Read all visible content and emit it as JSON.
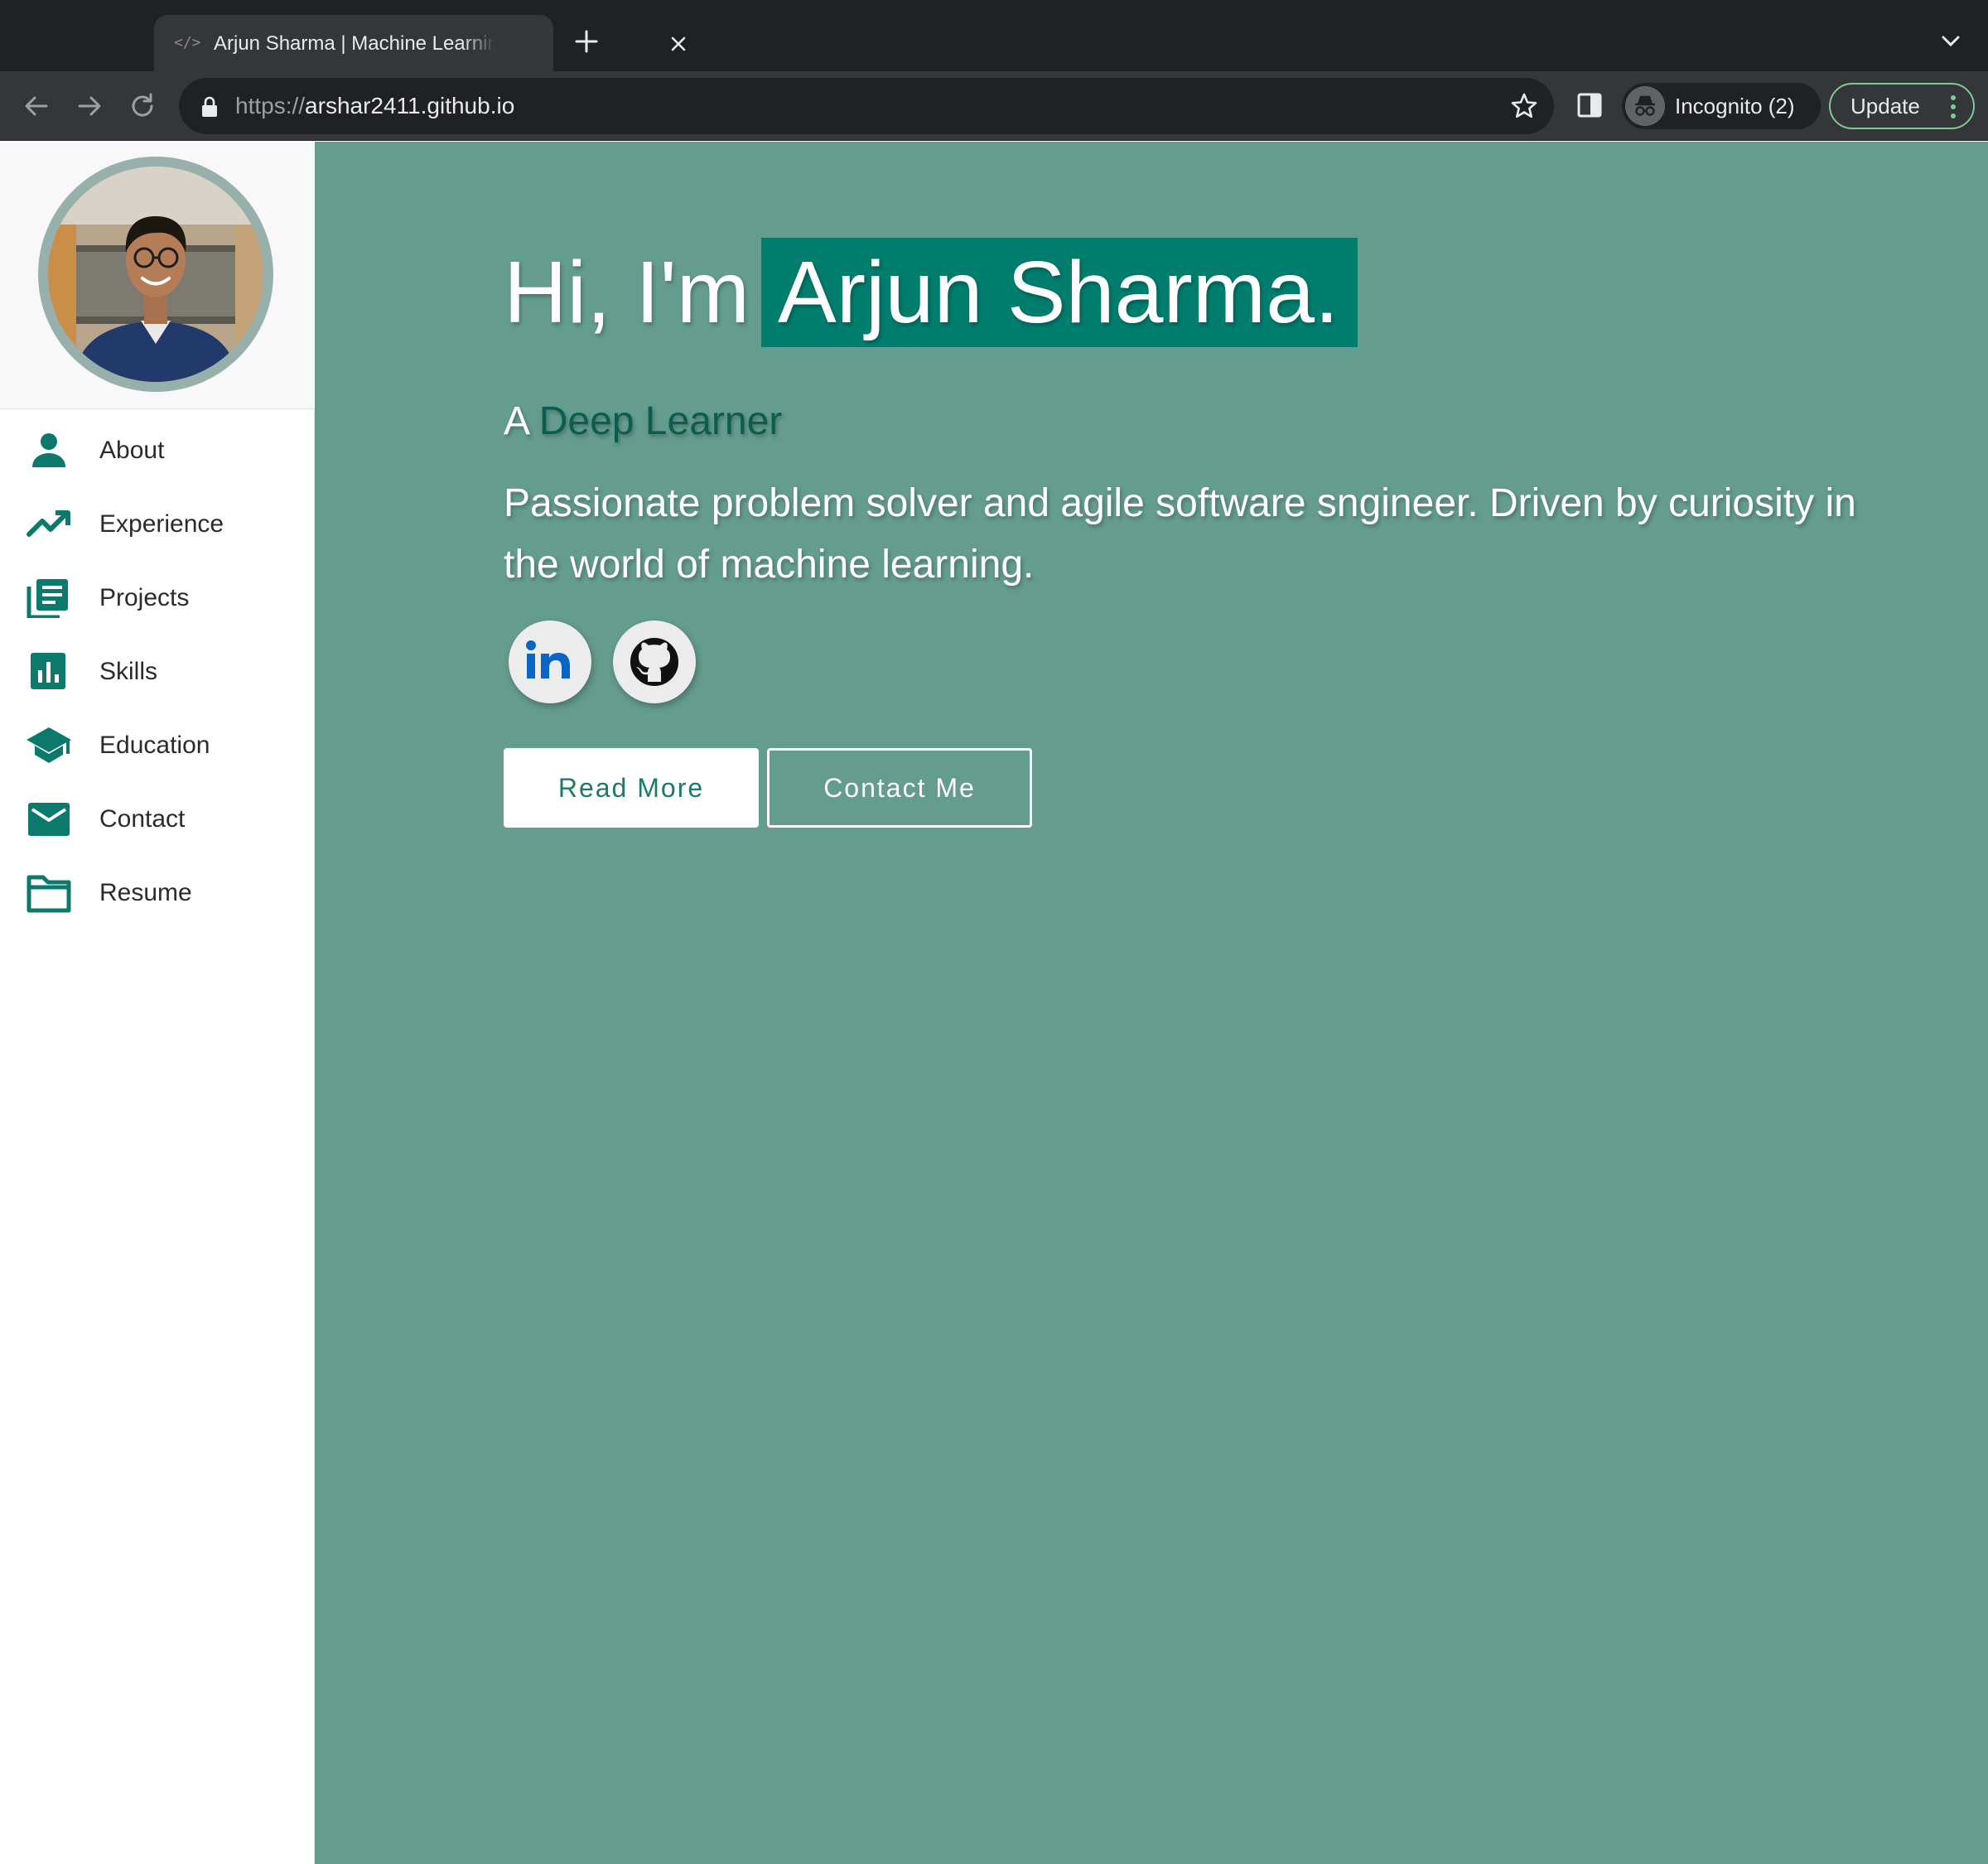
{
  "browser": {
    "tab_title": "Arjun Sharma | Machine Learning",
    "url_scheme": "https://",
    "url_host": "arshar2411.github.io",
    "incognito_label": "Incognito (2)",
    "update_label": "Update"
  },
  "sidebar": {
    "items": [
      {
        "label": "About",
        "icon": "person-icon"
      },
      {
        "label": "Experience",
        "icon": "trending-up-icon"
      },
      {
        "label": "Projects",
        "icon": "library-books-icon"
      },
      {
        "label": "Skills",
        "icon": "bar-chart-icon"
      },
      {
        "label": "Education",
        "icon": "graduation-cap-icon"
      },
      {
        "label": "Contact",
        "icon": "mail-icon"
      },
      {
        "label": "Resume",
        "icon": "folder-icon"
      }
    ]
  },
  "hero": {
    "greeting": "Hi, I'm",
    "name": "Arjun Sharma.",
    "sub_prefix": "A",
    "sub_role": "Deep Learner",
    "description": "Passionate problem solver and agile software sngineer. Driven by curiosity in the world of machine learning.",
    "read_more_label": "Read More",
    "contact_label": "Contact Me"
  },
  "colors": {
    "hero_background": "#649c8d",
    "name_highlight": "#017d6e",
    "icon_teal": "#0b7a6c",
    "role_accent": "#0c5d4f"
  }
}
